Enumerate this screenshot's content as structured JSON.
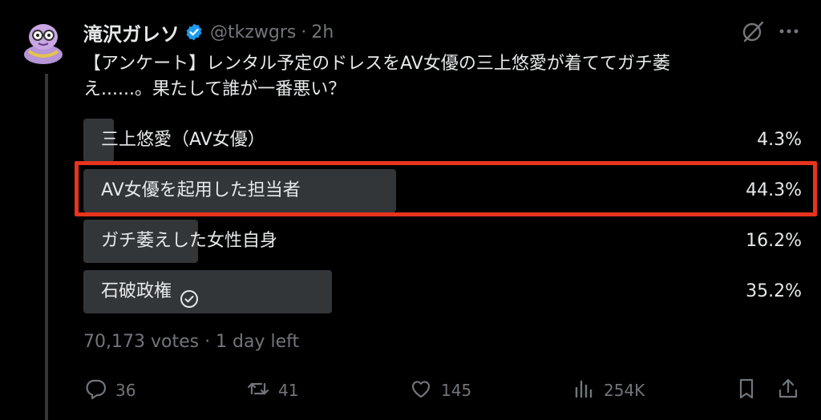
{
  "tweet": {
    "author_name": "滝沢ガレソ",
    "handle": "@tkzwgrs",
    "separator": "·",
    "time": "2h",
    "text_line1": "【アンケート】レンタル予定のドレスをAV女優の三上悠愛が着ててガチ萎",
    "text_line2": "え......。果たして誰が一番悪い？"
  },
  "poll": {
    "options": [
      {
        "label": "三上悠愛（AV女優）",
        "percent": "4.3%",
        "value": 4.3,
        "highlighted": false,
        "voted": false
      },
      {
        "label": "AV女優を起用した担当者",
        "percent": "44.3%",
        "value": 44.3,
        "highlighted": true,
        "voted": false
      },
      {
        "label": "ガチ萎えした女性自身",
        "percent": "16.2%",
        "value": 16.2,
        "highlighted": false,
        "voted": false
      },
      {
        "label": "石破政権",
        "percent": "35.2%",
        "value": 35.2,
        "highlighted": false,
        "voted": true
      }
    ],
    "meta": "70,173 votes · 1 day left"
  },
  "actions": {
    "replies": "36",
    "reposts": "41",
    "likes": "145",
    "views": "254K"
  },
  "colors": {
    "background": "#000000",
    "text": "#e7e9ea",
    "muted": "#71767b",
    "bar": "#333639",
    "verified": "#1d9bf0",
    "highlight_box": "#e8341d"
  },
  "icons": {
    "verified": "verified-badge-icon",
    "grok": "grok-icon",
    "more": "more-icon",
    "voted": "check-circle-icon",
    "reply": "reply-icon",
    "repost": "repost-icon",
    "like": "heart-icon",
    "views": "views-icon",
    "bookmark": "bookmark-icon",
    "share": "share-icon"
  }
}
